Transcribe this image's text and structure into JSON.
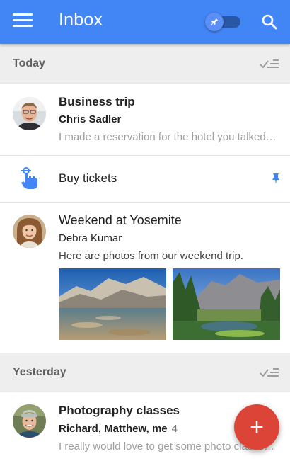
{
  "header": {
    "title": "Inbox",
    "menu_icon": "hamburger-menu-icon",
    "toggle_icon": "pin-icon",
    "search_icon": "search-icon",
    "bar_color": "#4285f4"
  },
  "sections": [
    {
      "label": "Today",
      "items": [
        {
          "type": "email",
          "subject": "Business trip",
          "sender": "Chris Sadler",
          "snippet": "I made a reservation for the hotel you talked about…"
        },
        {
          "type": "reminder",
          "title": "Buy tickets",
          "icon": "reminder-hand-icon",
          "pin_icon": "pin-icon"
        },
        {
          "type": "email",
          "subject": "Weekend at Yosemite",
          "sender": "Debra Kumar",
          "snippet": "Here are photos from our weekend trip."
        }
      ]
    },
    {
      "label": "Yesterday",
      "items": [
        {
          "type": "email",
          "subject": "Photography classes",
          "sender": "Richard, Matthew, me",
          "count": "4",
          "snippet": "I really would love to get some photo classes with you"
        }
      ]
    }
  ],
  "fab": {
    "label": "+",
    "color": "#db4437"
  }
}
